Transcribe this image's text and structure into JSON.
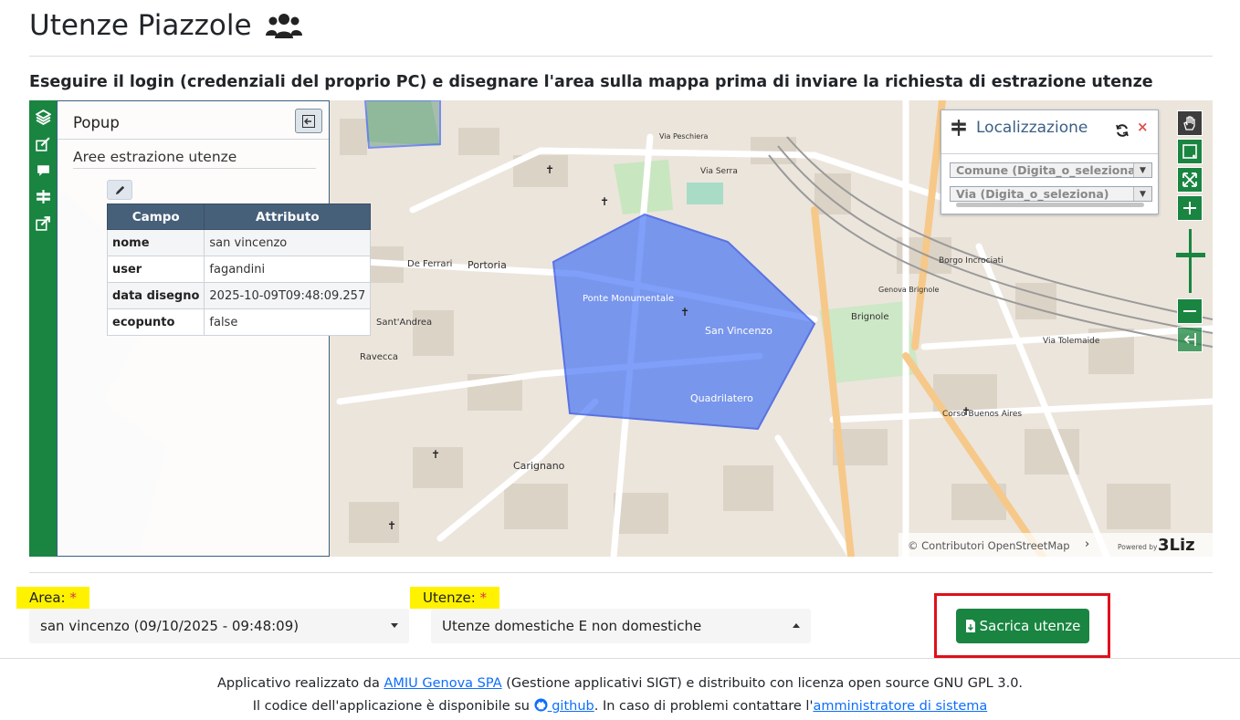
{
  "header": {
    "title": "Utenze Piazzole",
    "title_icon": "users-icon",
    "instruction": "Eseguire il login (credenziali del proprio PC) e disegnare l'area sulla mappa prima di inviare la richiesta di estrazione utenze"
  },
  "map": {
    "left_toolbar": [
      "layers-icon",
      "draw-icon",
      "comment-icon",
      "signpost-icon",
      "share-icon"
    ],
    "popup": {
      "title": "Popup",
      "layer_name": "Aree estrazione utenze",
      "columns": [
        "Campo",
        "Attributo"
      ],
      "rows": [
        {
          "campo": "nome",
          "attributo": "san vincenzo"
        },
        {
          "campo": "user",
          "attributo": "fagandini"
        },
        {
          "campo": "data disegno",
          "attributo": "2025-10-09T09:48:09.257"
        },
        {
          "campo": "ecopunto",
          "attributo": "false"
        }
      ]
    },
    "localizzazione": {
      "title": "Localizzazione",
      "comune_placeholder": "Comune (Digita_o_seleziona)",
      "via_placeholder": "Via (Digita_o_seleziona)"
    },
    "right_toolbar": [
      "pan-hand-icon",
      "zoom-box-icon",
      "zoom-extent-icon",
      "zoom-in-icon",
      "zoom-out-icon",
      "previous-extent-icon"
    ],
    "labels": {
      "de_ferrari": "De Ferrari",
      "portoria": "Portoria",
      "ponte_monumentale": "Ponte Monumentale",
      "san_vincenzo": "San Vincenzo",
      "quadrilatero": "Quadrilatero",
      "carignano": "Carignano",
      "sant_andrea": "Sant'Andrea",
      "ravecca": "Ravecca",
      "brignole": "Brignole",
      "genova_brignole": "Genova Brignole",
      "borgo_incrociati": "Borgo Incrociati",
      "via_serra": "Via Serra",
      "via_tolemaide": "Via Tolemaide",
      "corso_buenos_aires": "Corso Buenos Aires",
      "via_pescheria": "Via Peschiera"
    },
    "attribution": {
      "osm": "© Contributori OpenStreetMap",
      "powered_by": "Powered by",
      "logo": "3Liz"
    }
  },
  "form": {
    "area_label": "Area:",
    "area_value": "san vincenzo (09/10/2025 - 09:48:09)",
    "utenze_label": "Utenze:",
    "utenze_value": "Utenze domestiche E non domestiche",
    "required_mark": "*",
    "download_label": "Sacrica utenze"
  },
  "footer": {
    "line1_prefix": "Applicativo realizzato da ",
    "line1_link": "AMIU Genova SPA",
    "line1_suffix": " (Gestione applicativi SIGT) e distribuito con licenza open source GNU GPL 3.0.",
    "line2_prefix": "Il codice dell'applicazione è disponibile su ",
    "line2_link": " github",
    "line2_middle": ". In caso di problemi contattare l'",
    "line2_link2": "amministratore di sistema"
  }
}
